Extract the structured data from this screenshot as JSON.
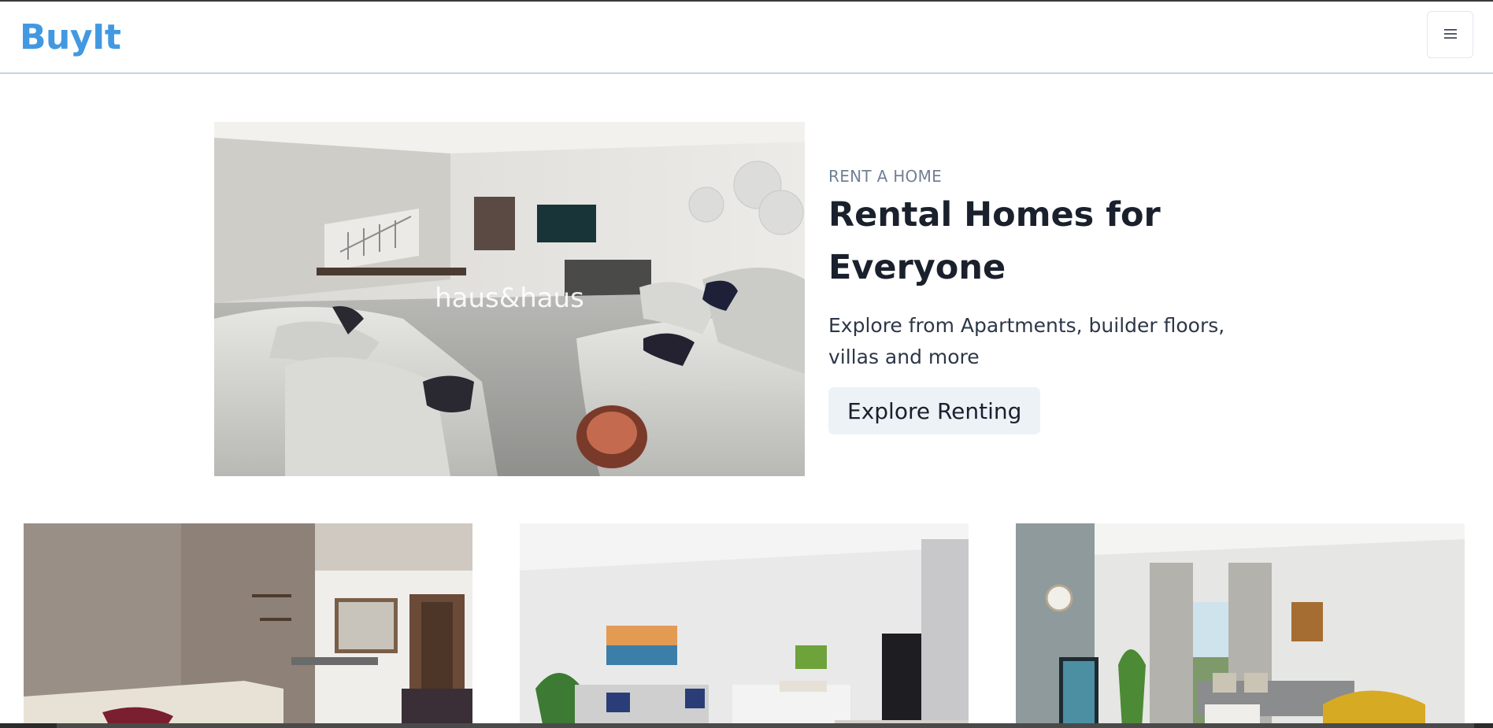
{
  "header": {
    "brand": "BuyIt",
    "menu_icon": "hamburger-menu-icon"
  },
  "hero": {
    "image_alt": "living room",
    "watermark": "haus&haus",
    "eyebrow": "RENT A HOME",
    "title": "Rental Homes for Everyone",
    "description": "Explore from Apartments, builder floors, villas and more",
    "cta_label": "Explore Renting"
  },
  "listings": [
    {
      "image_alt": "apartment living room with dining area"
    },
    {
      "image_alt": "studio apartment with bed and sofa"
    },
    {
      "image_alt": "living room with balcony view"
    }
  ],
  "colors": {
    "brand": "#4299e1",
    "eyebrow": "#718096",
    "cta_bg": "#edf2f7"
  }
}
